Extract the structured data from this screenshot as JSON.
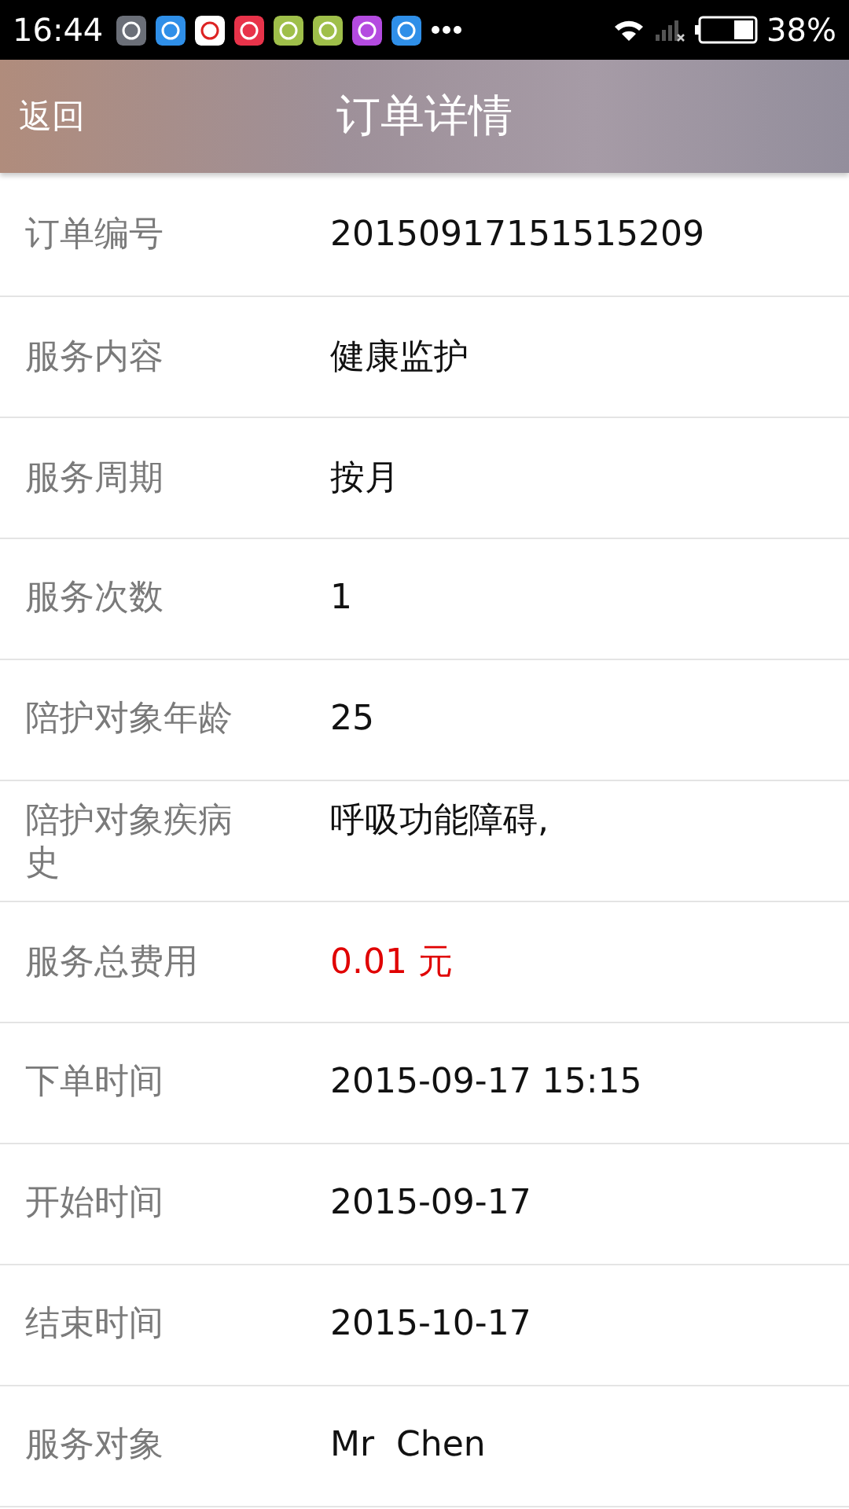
{
  "status_bar": {
    "time": "16:44",
    "battery_text": "38%"
  },
  "header": {
    "back": "返回",
    "title": "订单详情"
  },
  "rows": [
    {
      "label": "订单编号",
      "value": "20150917151515209",
      "highlight": false
    },
    {
      "label": "服务内容",
      "value": "健康监护",
      "highlight": false
    },
    {
      "label": "服务周期",
      "value": "按月",
      "highlight": false
    },
    {
      "label": "服务次数",
      "value": "1",
      "highlight": false
    },
    {
      "label": "陪护对象年龄",
      "value": "25",
      "highlight": false
    },
    {
      "label": "陪护对象疾病史",
      "value": "呼吸功能障碍,",
      "highlight": false
    },
    {
      "label": "服务总费用",
      "value": "0.01 元",
      "highlight": true
    },
    {
      "label": "下单时间",
      "value": "2015-09-17 15:15",
      "highlight": false
    },
    {
      "label": "开始时间",
      "value": "2015-09-17",
      "highlight": false
    },
    {
      "label": "结束时间",
      "value": "2015-10-17",
      "highlight": false
    },
    {
      "label": "服务对象",
      "value": "Mr  Chen",
      "highlight": false
    }
  ]
}
